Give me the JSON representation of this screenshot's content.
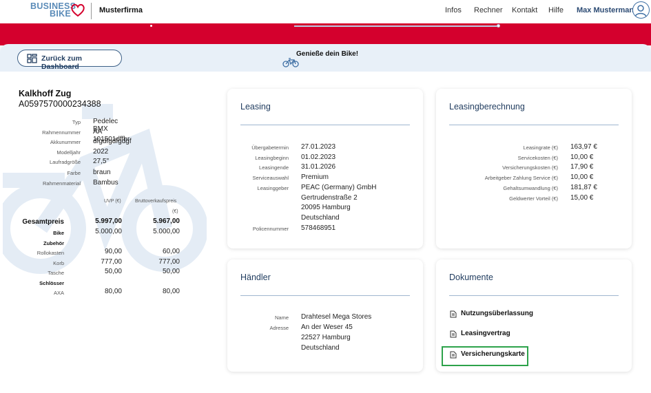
{
  "nav": {
    "logo_line1": "BUSINESS",
    "logo_line2": "BIKE",
    "company": "Musterfirma",
    "links": [
      "Infos",
      "Rechner",
      "Kontakt",
      "Hilfe"
    ],
    "user": "Max Mustermann"
  },
  "progress": {
    "back_label": "Zurück zum Dashboard",
    "title": "Genieße dein Bike!",
    "value": 0.41
  },
  "product": {
    "name": "Kalkhoff Zug",
    "id": "A0597570000234388",
    "specs": [
      {
        "label": "Typ",
        "value": "Pedelec BMX"
      },
      {
        "label": "Rahmennummer",
        "value": "AA 101501dffhr"
      },
      {
        "label": "Akkunummer",
        "value": "dfgdfgdfgdgf"
      },
      {
        "label": "Modelljahr",
        "value": "2022"
      },
      {
        "label": "Laufradgröße",
        "value": "27,5\""
      },
      {
        "label": "Farbe",
        "value": "braun"
      },
      {
        "label": "Rahmenmaterial",
        "value": "Bambus"
      }
    ],
    "price_headers": {
      "uvp": "UVP (€)",
      "brutto_line1": "Bruttoverkaufspreis",
      "brutto_line2": "(€)"
    },
    "prices": [
      {
        "label": "Gesamtpreis",
        "uvp": "5.997,00",
        "brutto": "5.967,00"
      },
      {
        "label": "Bike",
        "uvp": "5.000,00",
        "brutto": "5.000,00"
      },
      {
        "label": "Zubehör",
        "uvp": "",
        "brutto": ""
      },
      {
        "label": "Rollokasten",
        "uvp": "90,00",
        "brutto": "60,00"
      },
      {
        "label": "Korb",
        "uvp": "777,00",
        "brutto": "777,00"
      },
      {
        "label": "Tasche",
        "uvp": "50,00",
        "brutto": "50,00"
      },
      {
        "label": "Schlösser",
        "uvp": "",
        "brutto": ""
      },
      {
        "label": "AXA",
        "uvp": "80,00",
        "brutto": "80,00"
      }
    ]
  },
  "leasing": {
    "title": "Leasing",
    "rows": [
      {
        "label": "Übergabetermin",
        "value": "27.01.2023"
      },
      {
        "label": "Leasingbeginn",
        "value": "01.02.2023"
      },
      {
        "label": "Leasingende",
        "value": "31.01.2026"
      },
      {
        "label": "Serviceauswahl",
        "value": "Premium"
      },
      {
        "label": "Leasinggeber",
        "value": "PEAC (Germany) GmbH"
      },
      {
        "label": "",
        "value": "Gertrudenstraße 2"
      },
      {
        "label": "",
        "value": "20095 Hamburg"
      },
      {
        "label": "",
        "value": "Deutschland"
      },
      {
        "label": "Policennummer",
        "value": "578468951"
      }
    ]
  },
  "calc": {
    "title": "Leasingberechnung",
    "rows": [
      {
        "label": "Leasingrate (€)",
        "value": "163,97 €"
      },
      {
        "label": "Servicekosten (€)",
        "value": "10,00 €"
      },
      {
        "label": "Versicherungskosten (€)",
        "value": "17,90 €"
      },
      {
        "label": "Arbeitgeber Zahlung Service (€)",
        "value": "10,00 €"
      },
      {
        "label": "Gehaltsumwandlung (€)",
        "value": "181,87 €"
      },
      {
        "label": "Geldwerter Vorteil (€)",
        "value": "15,00 €"
      }
    ]
  },
  "dealer": {
    "title": "Händler",
    "rows": [
      {
        "label": "Name",
        "value": "Drahtesel Mega Stores"
      },
      {
        "label": "Adresse",
        "value": "An der Weser 45"
      },
      {
        "label": "",
        "value": "22527 Hamburg"
      },
      {
        "label": "",
        "value": "Deutschland"
      }
    ]
  },
  "docs": {
    "title": "Dokumente",
    "items": [
      "Nutzungsüberlassung",
      "Leasingvertrag",
      "Versicherungskarte"
    ]
  },
  "colors": {
    "brand_red": "#d4002d",
    "brand_blue": "#1f3b5e",
    "highlight_green": "#2ca24a"
  }
}
